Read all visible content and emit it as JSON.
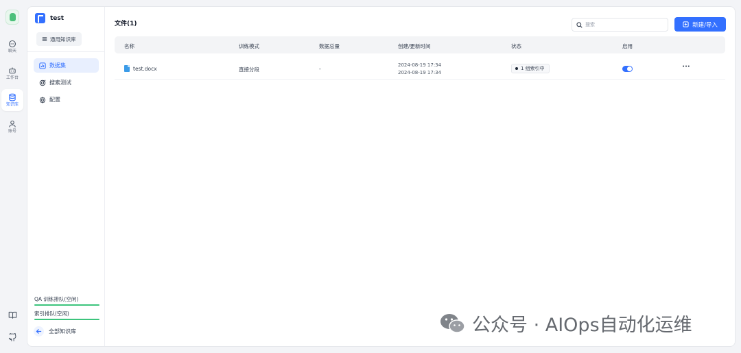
{
  "rail": {
    "items": [
      {
        "label": "聊天",
        "icon": "chat-icon"
      },
      {
        "label": "工作台",
        "icon": "robot-icon"
      },
      {
        "label": "知识库",
        "icon": "database-icon"
      },
      {
        "label": "账号",
        "icon": "user-icon"
      }
    ],
    "bottom": [
      {
        "icon": "book-icon"
      },
      {
        "icon": "github-icon"
      }
    ]
  },
  "kb": {
    "name": "test",
    "type_label": "通用知识库"
  },
  "nav": [
    {
      "label": "数据集",
      "icon": "dataset-icon",
      "active": true
    },
    {
      "label": "搜索测试",
      "icon": "search-test-icon",
      "active": false
    },
    {
      "label": "配置",
      "icon": "settings-icon",
      "active": false
    }
  ],
  "queues": {
    "qa": "QA 训练排队(空闲)",
    "index": "索引排队(空闲)"
  },
  "back_label": "全部知识库",
  "main": {
    "title": "文件(1)",
    "search_placeholder": "搜索",
    "new_button": "新建/导入"
  },
  "table": {
    "headers": [
      "名称",
      "训练模式",
      "数据总量",
      "创建/更新时间",
      "状态",
      "启用"
    ],
    "rows": [
      {
        "name": "test.docx",
        "mode": "直接分段",
        "total": "-",
        "created": "2024-08-19 17:34",
        "updated": "2024-08-19 17:34",
        "status": "1 组索引中",
        "enabled": true,
        "more": "···"
      }
    ]
  },
  "watermark": "公众号 · AIOps自动化运维",
  "colors": {
    "accent": "#3370ff",
    "queue_bar": "#3cc47c",
    "background": "#f3f4f7"
  }
}
